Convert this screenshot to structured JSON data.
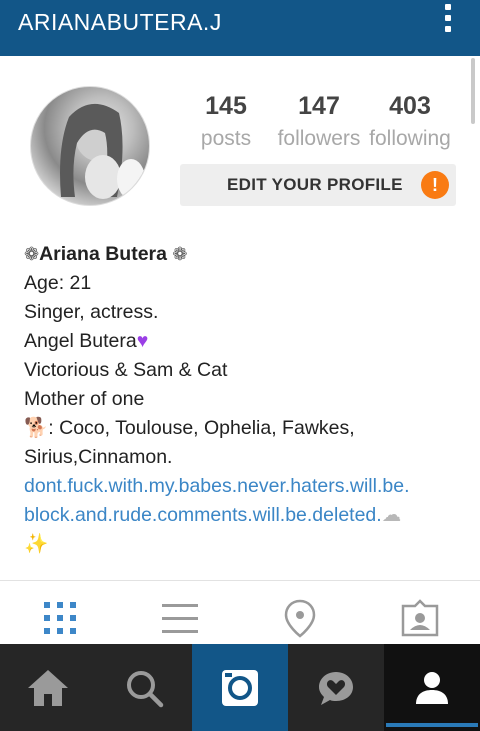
{
  "header": {
    "username": "ARIANABUTERA.J"
  },
  "stats": {
    "posts": {
      "count": "145",
      "label": "posts"
    },
    "followers": {
      "count": "147",
      "label": "followers"
    },
    "following": {
      "count": "403",
      "label": "following"
    }
  },
  "edit_profile": {
    "label": "EDIT YOUR PROFILE",
    "alert_glyph": "!"
  },
  "bio": {
    "name": "Ariana Butera",
    "lines": [
      "Age: 21",
      "Singer, actress.",
      "Angel Butera",
      "Victorious & Sam & Cat",
      "Mother of one",
      ": Coco, Toulouse, Ophelia, Fawkes,",
      "Sirius,Cinnamon."
    ],
    "link_line1": "dont.fuck.with.my.babes.never.haters.will.be.",
    "link_line2": "block.and.rude.comments.will.be.deleted."
  },
  "view_tabs": [
    "grid-icon",
    "list-icon",
    "map-pin-icon",
    "tagged-photos-icon"
  ],
  "bottom_nav": [
    "home-icon",
    "search-icon",
    "camera-icon",
    "activity-heart-icon",
    "profile-icon"
  ],
  "colors": {
    "header_bg": "#125688",
    "link": "#3b86c6",
    "alert": "#f97b13",
    "nav_bg": "#262626",
    "active_tab": "#125688"
  }
}
